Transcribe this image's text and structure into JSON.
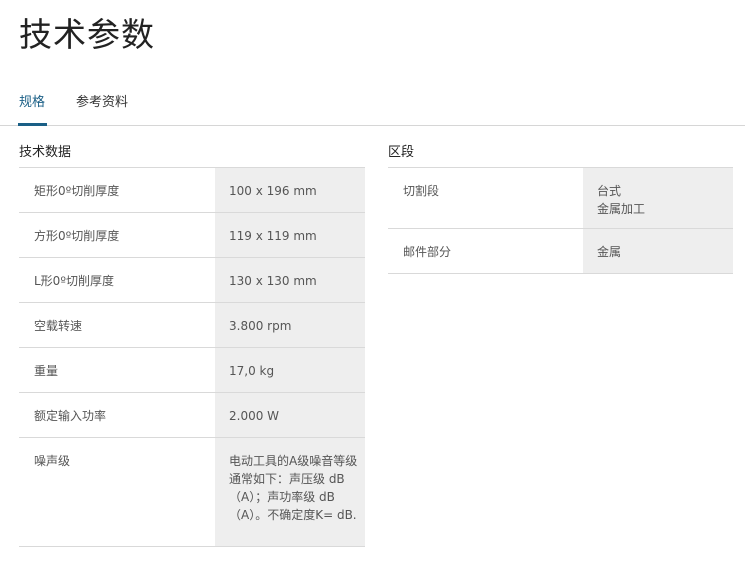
{
  "page": {
    "title": "技术参数"
  },
  "tabs": [
    {
      "label": "规格",
      "active": true
    },
    {
      "label": "参考资料",
      "active": false
    }
  ],
  "technical_data": {
    "title": "技术数据",
    "rows": [
      {
        "label": "矩形0º切削厚度",
        "value": "100 x 196 mm"
      },
      {
        "label": "方形0º切削厚度",
        "value": "119 x 119 mm"
      },
      {
        "label": "L形0º切削厚度",
        "value": "130 x 130 mm"
      },
      {
        "label": "空载转速",
        "value": "3.800 rpm"
      },
      {
        "label": "重量",
        "value": "17,0 kg"
      },
      {
        "label": "额定输入功率",
        "value": "2.000 W"
      },
      {
        "label": "噪声级",
        "value": "电动工具的A级噪音等级通常如下：声压级 dB（A）；声功率级 dB（A）。不确定度K= dB."
      }
    ]
  },
  "segment": {
    "title": "区段",
    "rows": [
      {
        "label": "切割段",
        "value": "台式\n金属加工"
      },
      {
        "label": "邮件部分",
        "value": "金属"
      }
    ]
  },
  "colors": {
    "accent": "#1a5f86",
    "value_cell_bg": "#eeeeee",
    "divider": "#d9d9d9"
  }
}
